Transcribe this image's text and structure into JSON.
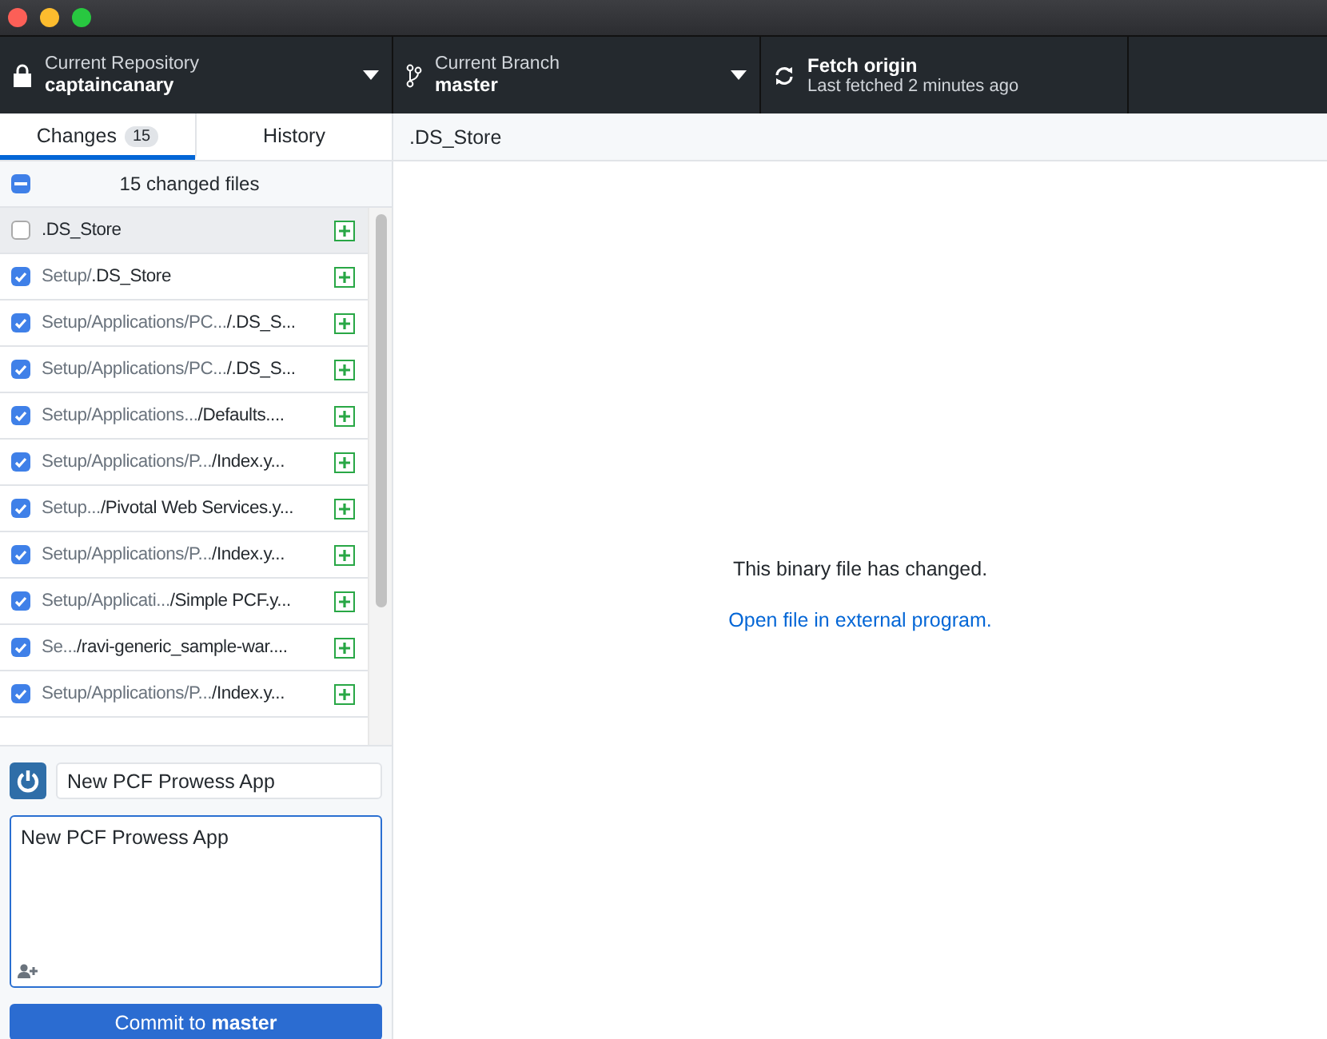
{
  "window": {
    "buttons": [
      {
        "kind": "close"
      },
      {
        "kind": "minimize"
      },
      {
        "kind": "zoom"
      }
    ]
  },
  "toolbar": {
    "repository": {
      "label": "Current Repository",
      "value": "captaincanary"
    },
    "branch": {
      "label": "Current Branch",
      "value": "master"
    },
    "fetch": {
      "title": "Fetch origin",
      "subtitle": "Last fetched 2 minutes ago"
    }
  },
  "tabs": [
    {
      "label": "Changes",
      "count": "15",
      "selected": true
    },
    {
      "label": "History",
      "selected": false
    }
  ],
  "changes": {
    "header": "15 changed files",
    "all_checked": {
      "indeterminate": true
    },
    "files": [
      {
        "name": ".DS_Store",
        "checked": false,
        "selected": true
      },
      {
        "dir": "Setup/",
        "name": ".DS_Store",
        "checked": true,
        "selected": false
      },
      {
        "dir": "Setup/Applications/PC...",
        "name": "/.DS_S...",
        "checked": true,
        "selected": false
      },
      {
        "dir": "Setup/Applications/PC...",
        "name": "/.DS_S...",
        "checked": true,
        "selected": false
      },
      {
        "dir": "Setup/Applications...",
        "name": "/Defaults....",
        "checked": true,
        "selected": false
      },
      {
        "dir": "Setup/Applications/P...",
        "name": "/Index.y...",
        "checked": true,
        "selected": false
      },
      {
        "dir": "Setup...",
        "name": "/Pivotal Web Services.y...",
        "checked": true,
        "selected": false
      },
      {
        "dir": "Setup/Applications/P...",
        "name": "/Index.y...",
        "checked": true,
        "selected": false
      },
      {
        "dir": "Setup/Applicati...",
        "name": "/Simple PCF.y...",
        "checked": true,
        "selected": false
      },
      {
        "dir": "Se...",
        "name": "/ravi-generic_sample-war....",
        "checked": true,
        "selected": false
      },
      {
        "dir": "Setup/Applications/P...",
        "name": "/Index.y...",
        "checked": true,
        "selected": false
      }
    ]
  },
  "commit": {
    "summary": "New PCF Prowess App",
    "description": "New PCF Prowess App",
    "button": "Commit to **master**"
  },
  "diff": {
    "file": ".DS_Store",
    "message": "This binary file has changed.",
    "link": "Open file in external program."
  }
}
